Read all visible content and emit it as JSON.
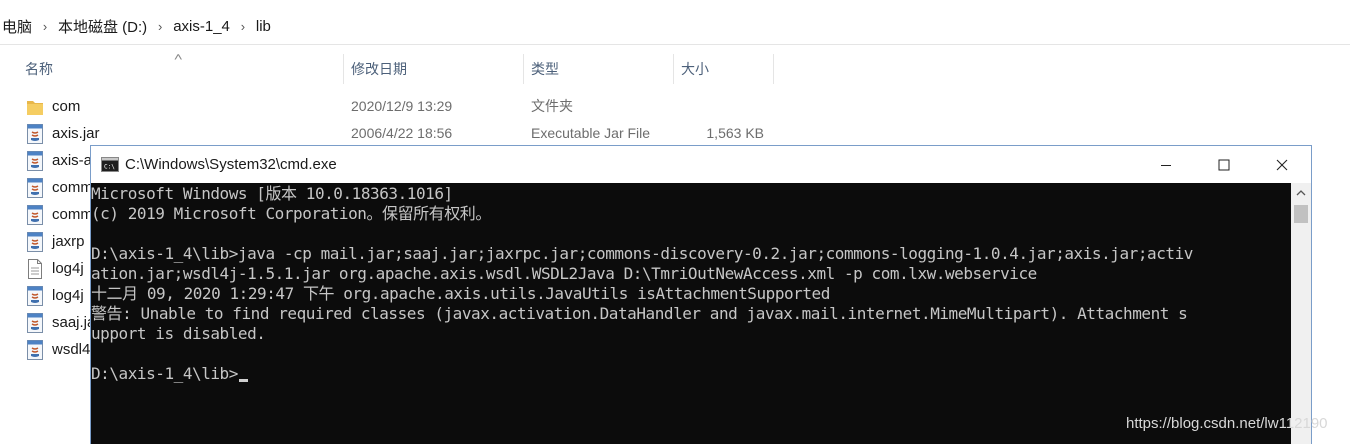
{
  "breadcrumb": {
    "items": [
      "电脑",
      "本地磁盘 (D:)",
      "axis-1_4",
      "lib"
    ]
  },
  "columns": {
    "name": "名称",
    "date": "修改日期",
    "type": "类型",
    "size": "大小"
  },
  "files": [
    {
      "name": "com",
      "date": "2020/12/9 13:29",
      "type": "文件夹",
      "size": "",
      "icon": "folder-icon"
    },
    {
      "name": "axis.jar",
      "date": "2006/4/22 18:56",
      "type": "Executable Jar File",
      "size": "1,563 KB",
      "icon": "jar-file-icon"
    },
    {
      "name": "axis-a",
      "date": "",
      "type": "",
      "size": "",
      "icon": "jar-file-icon"
    },
    {
      "name": "comm",
      "date": "",
      "type": "",
      "size": "",
      "icon": "jar-file-icon"
    },
    {
      "name": "comm",
      "date": "",
      "type": "",
      "size": "",
      "icon": "jar-file-icon"
    },
    {
      "name": "jaxrp",
      "date": "",
      "type": "",
      "size": "",
      "icon": "jar-file-icon"
    },
    {
      "name": "log4j",
      "date": "",
      "type": "",
      "size": "",
      "icon": "text-file-icon"
    },
    {
      "name": "log4j",
      "date": "",
      "type": "",
      "size": "",
      "icon": "jar-file-icon"
    },
    {
      "name": "saaj.ja",
      "date": "",
      "type": "",
      "size": "",
      "icon": "jar-file-icon"
    },
    {
      "name": "wsdl4",
      "date": "",
      "type": "",
      "size": "",
      "icon": "jar-file-icon"
    }
  ],
  "cmd": {
    "title": "C:\\Windows\\System32\\cmd.exe",
    "lines": [
      "Microsoft Windows [版本 10.0.18363.1016]",
      "(c) 2019 Microsoft Corporation。保留所有权利。",
      "",
      "D:\\axis-1_4\\lib>java -cp mail.jar;saaj.jar;jaxrpc.jar;commons-discovery-0.2.jar;commons-logging-1.0.4.jar;axis.jar;activ",
      "ation.jar;wsdl4j-1.5.1.jar org.apache.axis.wsdl.WSDL2Java D:\\TmriOutNewAccess.xml -p com.lxw.webservice",
      "十二月 09, 2020 1:29:47 下午 org.apache.axis.utils.JavaUtils isAttachmentSupported",
      "警告: Unable to find required classes (javax.activation.DataHandler and javax.mail.internet.MimeMultipart). Attachment s",
      "upport is disabled.",
      "",
      "D:\\axis-1_4\\lib>"
    ]
  },
  "watermark": "https://blog.csdn.net/lw112190",
  "colors": {
    "console_bg": "#0c0c0c",
    "console_text": "#c6c6c6",
    "header_text": "#4c607a",
    "folder": "#e8b74a"
  }
}
